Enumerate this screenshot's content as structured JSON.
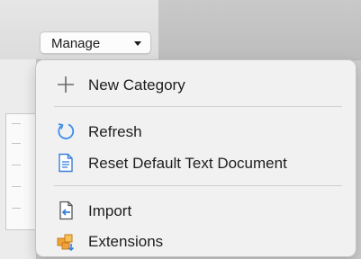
{
  "toolbar": {
    "manage_label": "Manage"
  },
  "menu": {
    "items": [
      {
        "label": "New Category",
        "icon": "plus-icon"
      },
      {
        "label": "Refresh",
        "icon": "refresh-icon"
      },
      {
        "label": "Reset Default Text Document",
        "icon": "document-icon"
      },
      {
        "label": "Import",
        "icon": "import-icon"
      },
      {
        "label": "Extensions",
        "icon": "extensions-icon"
      }
    ]
  },
  "colors": {
    "refresh_blue": "#3f8ee8",
    "document_blue": "#3a7fd8",
    "extensions_orange": "#f0a23a"
  }
}
